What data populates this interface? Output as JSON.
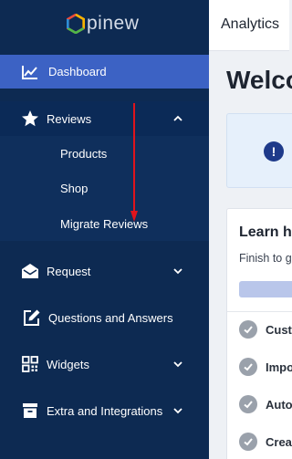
{
  "app": {
    "logo_text": "pinew"
  },
  "sidebar": {
    "items": [
      {
        "label": "Dashboard",
        "icon": "chart-icon"
      },
      {
        "label": "Reviews",
        "icon": "star-icon",
        "expanded": true,
        "children": [
          {
            "label": "Products"
          },
          {
            "label": "Shop"
          },
          {
            "label": "Migrate Reviews"
          }
        ]
      },
      {
        "label": "Request",
        "icon": "envelope-icon"
      },
      {
        "label": "Questions and Answers",
        "icon": "edit-icon"
      },
      {
        "label": "Widgets",
        "icon": "widgets-icon"
      },
      {
        "label": "Extra and Integrations",
        "icon": "archive-icon"
      }
    ]
  },
  "header": {
    "title": "Analytics"
  },
  "main": {
    "welcome": "Welco",
    "card": {
      "title": "Learn h",
      "subtitle": "Finish to g",
      "tasks": [
        {
          "label": "Cust"
        },
        {
          "label": "Impo"
        },
        {
          "label": "Auto"
        },
        {
          "label": "Crea"
        }
      ]
    }
  },
  "colors": {
    "sidebar_bg": "#0d2a52",
    "active_bg": "#3c62c4",
    "annotation_arrow": "#e0141c",
    "progress": "#b9c6ea"
  }
}
